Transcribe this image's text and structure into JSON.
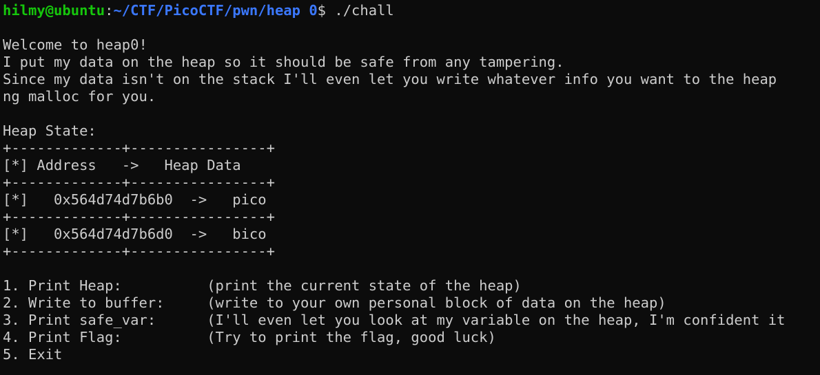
{
  "prompt": {
    "user_host": "hilmy@ubuntu",
    "colon": ":",
    "path": "~/CTF/PicoCTF/pwn/heap 0",
    "dollar": "$",
    "command": " ./chall"
  },
  "intro": [
    "Welcome to heap0!",
    "I put my data on the heap so it should be safe from any tampering.",
    "Since my data isn't on the stack I'll even let you write whatever info you want to the heap",
    "ng malloc for you."
  ],
  "heap_title": "Heap State:",
  "table": {
    "border": "+-------------+----------------+",
    "header": "[*] Address   ->   Heap Data",
    "rows": [
      "[*]   0x564d74d7b6b0  ->   pico",
      "[*]   0x564d74d7b6d0  ->   bico"
    ]
  },
  "menu": [
    "1. Print Heap:          (print the current state of the heap)",
    "2. Write to buffer:     (write to your own personal block of data on the heap)",
    "3. Print safe_var:      (I'll even let you look at my variable on the heap, I'm confident it",
    "4. Print Flag:          (Try to print the flag, good luck)",
    "5. Exit"
  ],
  "colors": {
    "background": "#0c0c0c",
    "text": "#cccccc",
    "prompt_user": "#16c60c",
    "prompt_path": "#3b78ff"
  }
}
